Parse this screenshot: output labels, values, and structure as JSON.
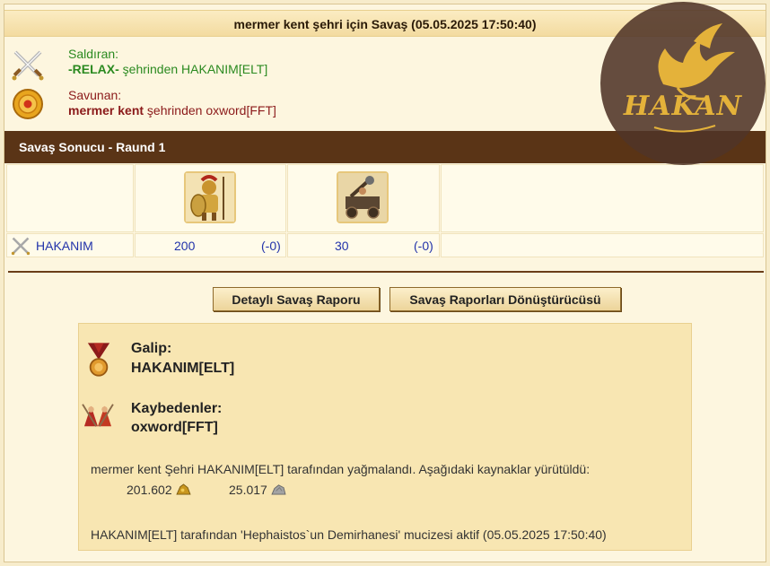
{
  "window": {
    "title": "mermer kent şehri için Savaş (05.05.2025 17:50:40)"
  },
  "attacker": {
    "role": "Saldıran:",
    "city": "-RELAX-",
    "suffix": " şehrinden HAKANIM[ELT]",
    "icon": "crossed-swords-icon"
  },
  "defender": {
    "role": "Savunan:",
    "city": "mermer kent",
    "suffix": " şehrinden oxword[FFT]",
    "icon": "shield-icon"
  },
  "round": {
    "title": "Savaş Sonucu - Raund 1",
    "player": "HAKANIM",
    "units": [
      {
        "icon": "hoplite-unit-icon",
        "count": "200",
        "loss": "(-0)"
      },
      {
        "icon": "catapult-unit-icon",
        "count": "30",
        "loss": "(-0)"
      }
    ]
  },
  "buttons": {
    "detailed_report": "Detaylı Savaş Raporu",
    "report_converter": "Savaş Raporları Dönüştürücüsü"
  },
  "result": {
    "winner_label": "Galip:",
    "winner_name": "HAKANIM[ELT]",
    "losers_label": "Kaybedenler:",
    "losers_name": "oxword[FFT]",
    "plunder_text": "mermer kent Şehri HAKANIM[ELT] tarafından yağmalandı. Aşağıdaki kaynaklar yürütüldü:",
    "resources": [
      {
        "amount": "201.602",
        "icon": "gold-icon"
      },
      {
        "amount": "25.017",
        "icon": "stone-icon"
      }
    ],
    "wonder_text": "HAKANIM[ELT] tarafından 'Hephaistos`un Demirhanesi' mucizesi aktif (05.05.2025 17:50:40)"
  },
  "watermark": {
    "text": "HAKAN",
    "colors": {
      "circle": "#50342a",
      "gold": "#e4b23a"
    }
  },
  "colors": {
    "attacker": "#2b8a20",
    "defender": "#8b1a1a",
    "header_dark": "#5a3416",
    "link_blue": "#2233aa"
  }
}
